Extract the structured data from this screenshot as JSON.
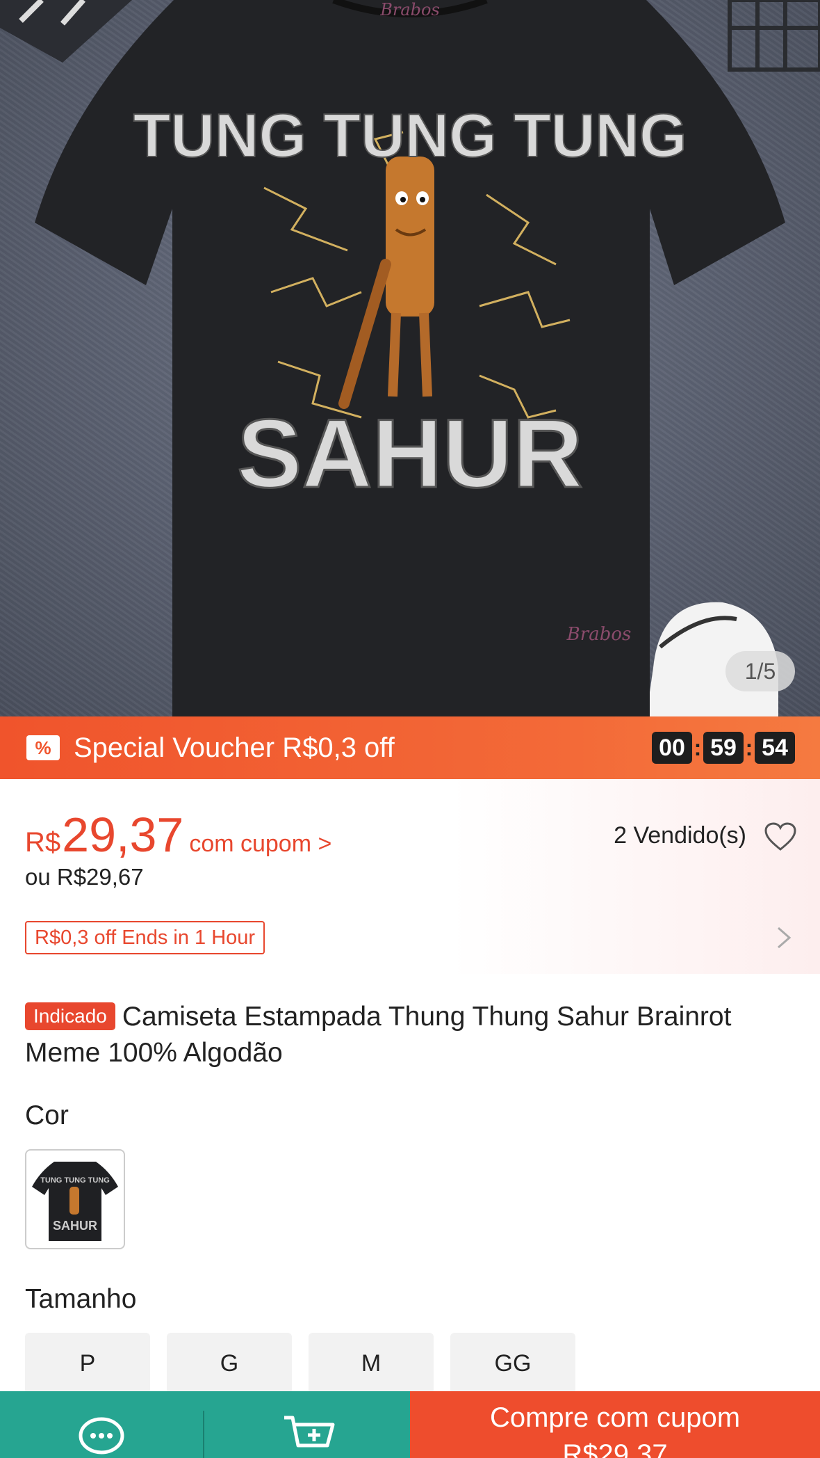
{
  "gallery": {
    "counter": "1/5",
    "print_top": "TUNG TUNG TUNG",
    "print_bottom": "SAHUR",
    "brand_mark": "Brabos"
  },
  "voucher": {
    "icon": "voucher-percent-icon",
    "text": "Special Voucher R$0,3 off",
    "timer": {
      "hours": "00",
      "minutes": "59",
      "seconds": "54",
      "sep": ":"
    }
  },
  "price": {
    "currency": "R$",
    "value": "29,37",
    "coupon_label": "com cupom >",
    "alt_price": "ou R$29,67",
    "sold": "2 Vendido(s)",
    "ends_badge": "R$0,3 off Ends in 1 Hour"
  },
  "product": {
    "tag": "Indicado",
    "title": "Camiseta Estampada Thung Thung Sahur Brainrot Meme 100% Algodão"
  },
  "options": {
    "color_label": "Cor",
    "color_thumb_top": "TUNG TUNG TUNG",
    "color_thumb_bottom": "SAHUR",
    "size_label": "Tamanho",
    "sizes": [
      "P",
      "G",
      "M",
      "GG"
    ]
  },
  "bottom_bar": {
    "chat_icon": "chat-icon",
    "cart_icon": "add-to-cart-icon",
    "buy_label": "Compre com cupom",
    "buy_price": "R$29,37"
  },
  "colors": {
    "accent": "#ee4d2d",
    "voucher_bg": "#f36a38",
    "bottom_teal": "#26a591"
  }
}
